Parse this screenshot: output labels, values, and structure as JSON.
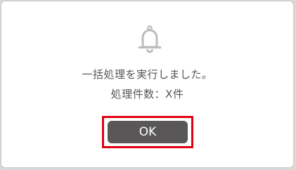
{
  "dialog": {
    "icon": "bell-icon",
    "message_line1": "一括処理を実行しました。",
    "message_line2": "処理件数：X件",
    "ok_label": "OK"
  },
  "colors": {
    "icon_gray": "#bdbdbd",
    "text_gray": "#555555",
    "button_bg": "#595757",
    "highlight_red": "#e00012"
  }
}
